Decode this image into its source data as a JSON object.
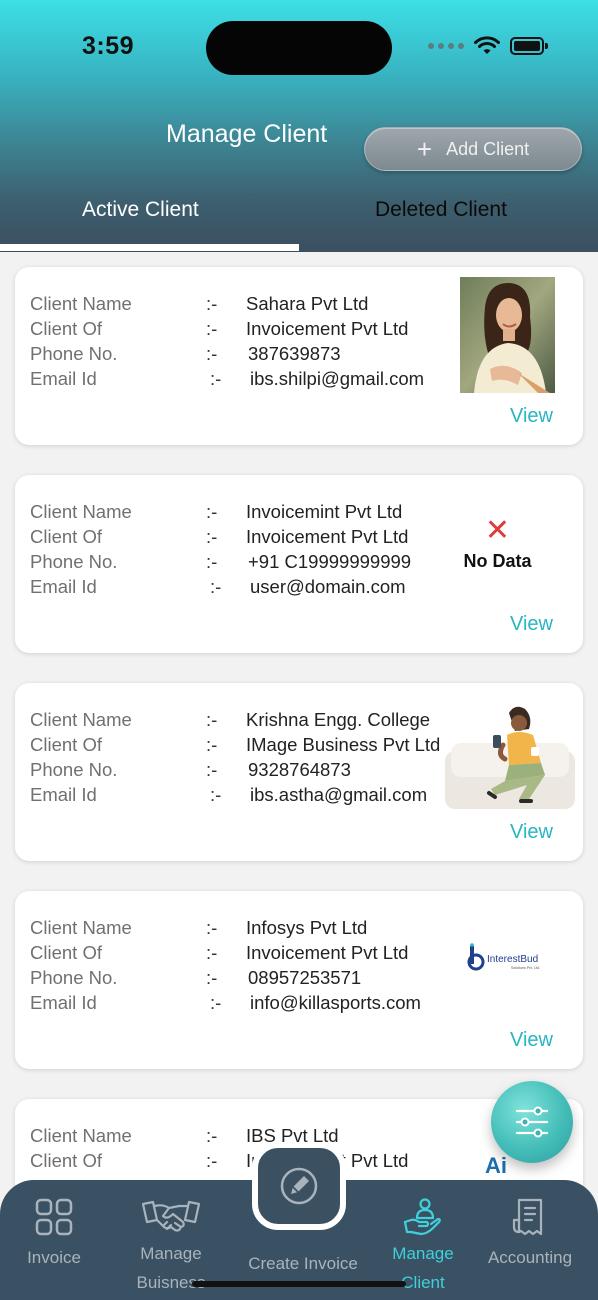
{
  "status_bar": {
    "time": "3:59"
  },
  "header": {
    "title": "Manage Client",
    "add_button_label": "Add Client",
    "tabs": {
      "active": "Active  Client",
      "deleted": "Deleted Client"
    }
  },
  "field_labels": {
    "client_name": "Client Name",
    "client_of": "Client Of",
    "phone": "Phone No.",
    "email": "Email Id",
    "separator": ":-"
  },
  "clients": [
    {
      "name": "Sahara Pvt Ltd",
      "client_of": "Invoicement Pvt Ltd",
      "phone": "387639873",
      "email": "ibs.shilpi@gmail.com",
      "view": "View",
      "thumb": "person-photo"
    },
    {
      "name": "Invoicemint Pvt Ltd",
      "client_of": "Invoicement Pvt Ltd",
      "phone": "+91 C19999999999",
      "email": "user@domain.com",
      "view": "View",
      "thumb": "no-data",
      "no_data_label": "No Data"
    },
    {
      "name": "Krishna Engg. College",
      "client_of": "IMage Business Pvt Ltd",
      "phone": "9328764873",
      "email": "ibs.astha@gmail.com",
      "view": "View",
      "thumb": "illustration"
    },
    {
      "name": "Infosys Pvt Ltd",
      "client_of": "Invoicement Pvt Ltd",
      "phone": "08957253571",
      "email": "info@killasports.com",
      "view": "View",
      "thumb": "logo",
      "logo_text": "InterestBud",
      "logo_subtext": "Solutions Pvt. Ltd."
    },
    {
      "name": "IBS Pvt Ltd",
      "client_of": "Invoicement Pvt Ltd",
      "logo_text": "Ai"
    }
  ],
  "bottom_nav": {
    "invoice": "Invoice",
    "manage_business_1": "Manage",
    "manage_business_2": "Buisness",
    "create_invoice": "Create Invoice",
    "manage_client_1": "Manage",
    "manage_client_2": "Client",
    "accounting": "Accounting"
  },
  "colors": {
    "accent": "#27b6c2",
    "nav_bg": "#3a5163",
    "nav_active": "#3fd0da",
    "no_data_x": "#e03a3a"
  }
}
